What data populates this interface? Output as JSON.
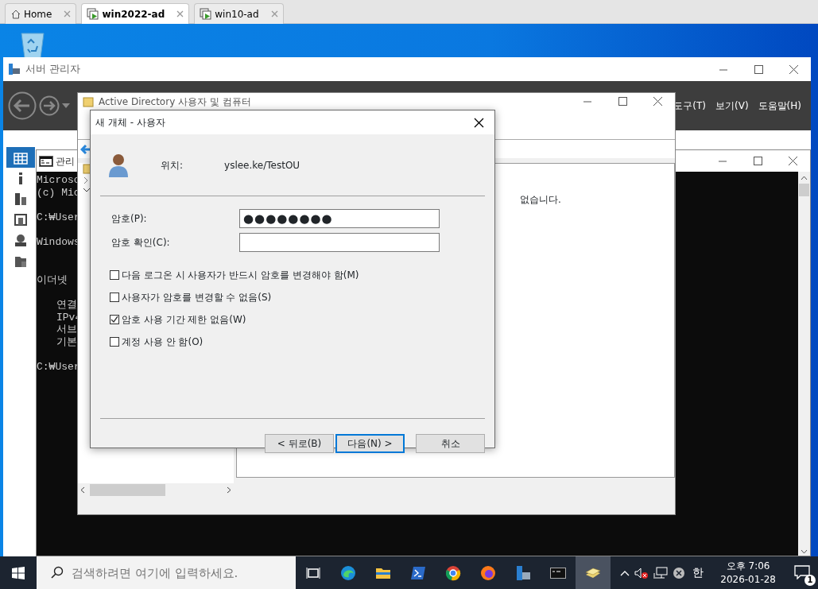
{
  "tabs": [
    {
      "kind": "home",
      "label": "Home",
      "selected": false
    },
    {
      "kind": "vm",
      "label": "win2022-ad",
      "selected": true
    },
    {
      "kind": "vm",
      "label": "win10-ad",
      "selected": false
    }
  ],
  "server_manager": {
    "title": "서버 관리자",
    "menu": [
      "도구(T)",
      "보기(V)",
      "도움말(H)"
    ],
    "sidebar_items": [
      {
        "kind": "dashboard",
        "selected": true
      },
      {
        "kind": "local",
        "selected": false
      },
      {
        "kind": "servers",
        "selected": false
      },
      {
        "kind": "ad",
        "selected": false
      },
      {
        "kind": "dns",
        "selected": false
      },
      {
        "kind": "files",
        "selected": false
      }
    ]
  },
  "console": {
    "title": "관리",
    "lines": [
      {
        "text": "Microso",
        "kind": "line",
        "indented": false
      },
      {
        "text": "(c) Mic",
        "kind": "line",
        "indented": false
      },
      {
        "text": "C:₩User",
        "kind": "after-gap",
        "indented": false
      },
      {
        "text": "Windows",
        "kind": "after-gap",
        "indented": false
      },
      {
        "text": "이더넷",
        "kind": "after-double-gap",
        "indented": false
      },
      {
        "text": "연결",
        "kind": "after-gap",
        "indented": true
      },
      {
        "text": "IPv4",
        "kind": "line",
        "indented": true
      },
      {
        "text": "서브",
        "kind": "line",
        "indented": true
      },
      {
        "text": "기본",
        "kind": "line",
        "indented": true
      },
      {
        "text": "C:₩User",
        "kind": "after-gap",
        "indented": false
      }
    ]
  },
  "aduc": {
    "title": "Active Directory 사용자 및 컴퓨터",
    "message": "없습니다."
  },
  "dialog": {
    "title": "새 개체 - 사용자",
    "location_label": "위치:",
    "location": "yslee.ke/TestOU",
    "fields": [
      {
        "label": "암호(P):",
        "value": "●●●●●●●●"
      },
      {
        "label": "암호 확인(C):"
      }
    ],
    "options": [
      {
        "label": "다음 로그온 시 사용자가 반드시 암호를 변경해야 함(M)",
        "checked": false
      },
      {
        "label": "사용자가 암호를 변경할 수 없음(S)",
        "checked": false
      },
      {
        "label": "암호 사용 기간 제한 없음(W)",
        "checked": true
      },
      {
        "label": "계정 사용 안 함(O)",
        "checked": false
      }
    ],
    "buttons": [
      {
        "label": "< 뒤로(B)",
        "default": false
      },
      {
        "label": "다음(N) >",
        "default": true
      },
      {
        "label": "취소",
        "default": false
      }
    ]
  },
  "taskbar": {
    "search": {
      "placeholder": "검색하려면 여기에 입력하세요."
    },
    "apps": [
      {
        "kind": "taskview",
        "selected": false
      },
      {
        "kind": "edge",
        "selected": false
      },
      {
        "kind": "explorer",
        "selected": false
      },
      {
        "kind": "powershell",
        "selected": false
      },
      {
        "kind": "chrome",
        "selected": false
      },
      {
        "kind": "firefox",
        "selected": false
      },
      {
        "kind": "servermanager",
        "selected": false
      },
      {
        "kind": "cmd",
        "selected": false
      },
      {
        "kind": "aduc",
        "selected": true
      }
    ],
    "ime": "한",
    "time": "오후 7:06",
    "date": "2026-01-28",
    "notifications": "1"
  }
}
